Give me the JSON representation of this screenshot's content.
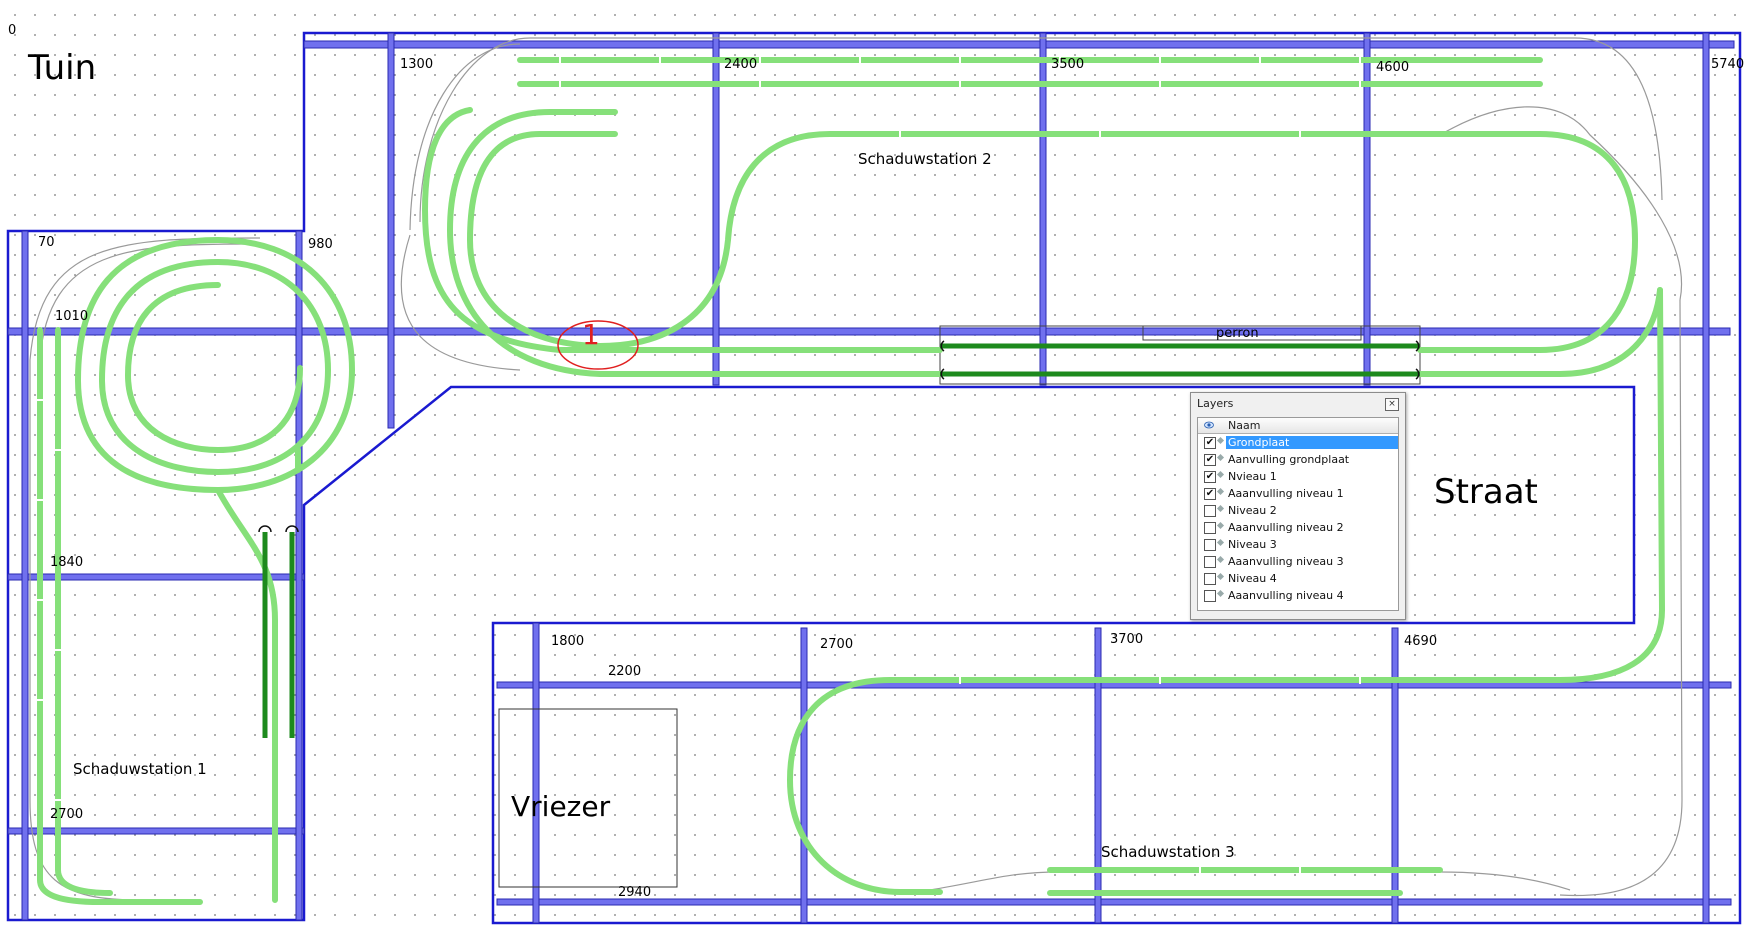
{
  "corner_label": "0",
  "rooms": {
    "tuin": "Tuin",
    "straat": "Straat",
    "vriezer": "Vriezer"
  },
  "stations": {
    "s1": "Schaduwstation 1",
    "s2": "Schaduwstation 2",
    "s3": "Schaduwstation 3",
    "perron": "perron"
  },
  "marker": "1",
  "dimensions": {
    "top": [
      "1300",
      "2400",
      "3500",
      "4600",
      "5740"
    ],
    "left": [
      "70",
      "980",
      "1010",
      "1840",
      "2700"
    ],
    "bottom": [
      "1800",
      "2200",
      "2700",
      "3700",
      "4690",
      "2940"
    ]
  },
  "layers": {
    "title": "Layers",
    "close": "×",
    "column": "Naam",
    "items": [
      {
        "name": "Grondplaat",
        "checked": true,
        "selected": true
      },
      {
        "name": "Aanvulling grondplaat",
        "checked": true
      },
      {
        "name": "Nvieau 1",
        "checked": true
      },
      {
        "name": "Aaanvulling niveau 1",
        "checked": true
      },
      {
        "name": "Niveau 2",
        "checked": false
      },
      {
        "name": "Aaanvulling niveau 2",
        "checked": false
      },
      {
        "name": "Niveau 3",
        "checked": false
      },
      {
        "name": "Aaanvulling niveau 3",
        "checked": false
      },
      {
        "name": "Niveau 4",
        "checked": false
      },
      {
        "name": "Aaanvulling niveau 4",
        "checked": false
      }
    ]
  },
  "colors": {
    "wall": "#1a1ad0",
    "beam": "#6e6ef0",
    "track_green": "#86e07a",
    "track_dark": "#1d8a1d",
    "marker": "#e02020"
  }
}
